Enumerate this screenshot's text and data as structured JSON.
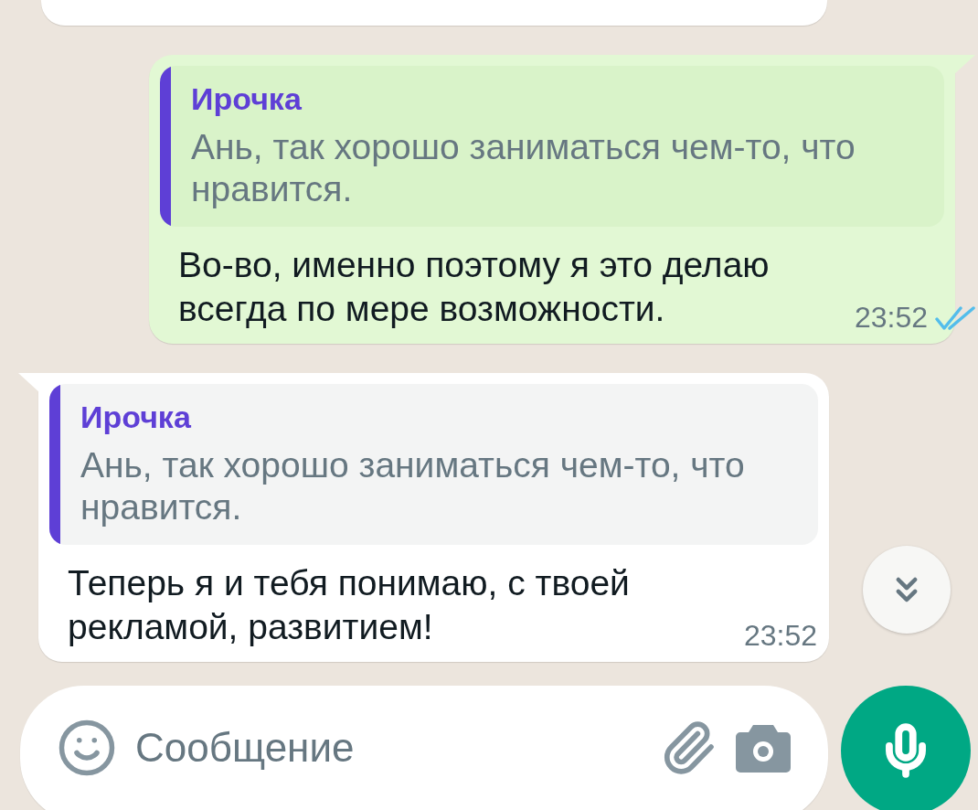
{
  "messages": [
    {
      "outgoing": true,
      "quote": {
        "author": "Ирочка",
        "text": "Ань, так хорошо заниматься чем-то, что нравится."
      },
      "text": "Во-во, именно поэтому я это делаю всегда по мере возможности.",
      "time": "23:52",
      "read": true
    },
    {
      "outgoing": false,
      "quote": {
        "author": "Ирочка",
        "text": "Ань, так хорошо заниматься чем-то, что нравится."
      },
      "text": "Теперь я и тебя понимаю, с твоей рекламой, развитием!",
      "time": "23:52"
    }
  ],
  "composer": {
    "placeholder": "Сообщение"
  }
}
